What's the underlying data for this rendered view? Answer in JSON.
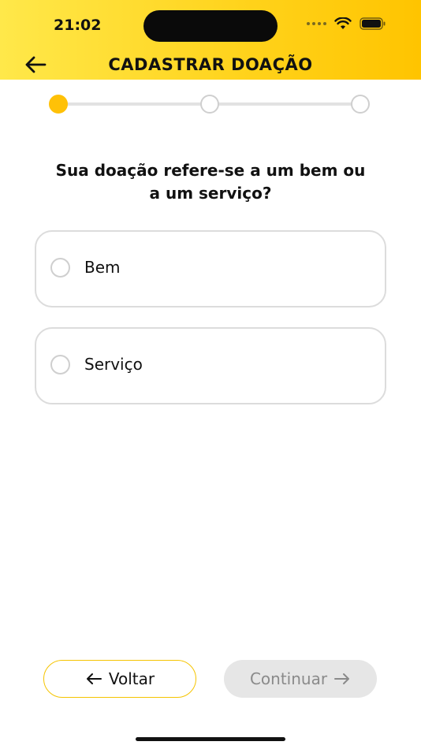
{
  "status_bar": {
    "time": "21:02"
  },
  "header": {
    "title": "CADASTRAR DOAÇÃO"
  },
  "stepper": {
    "current_step": 1,
    "total_steps": 3
  },
  "question": {
    "line1": "Sua doação refere-se a um bem ou",
    "line2": "a um serviço?"
  },
  "options": [
    {
      "label": "Bem"
    },
    {
      "label": "Serviço"
    }
  ],
  "footer": {
    "back_label": "Voltar",
    "continue_label": "Continuar"
  },
  "colors": {
    "accent": "#ffc107",
    "header_start": "#ffe84a",
    "header_end": "#ffc400",
    "disabled_bg": "#e6e6e6"
  }
}
